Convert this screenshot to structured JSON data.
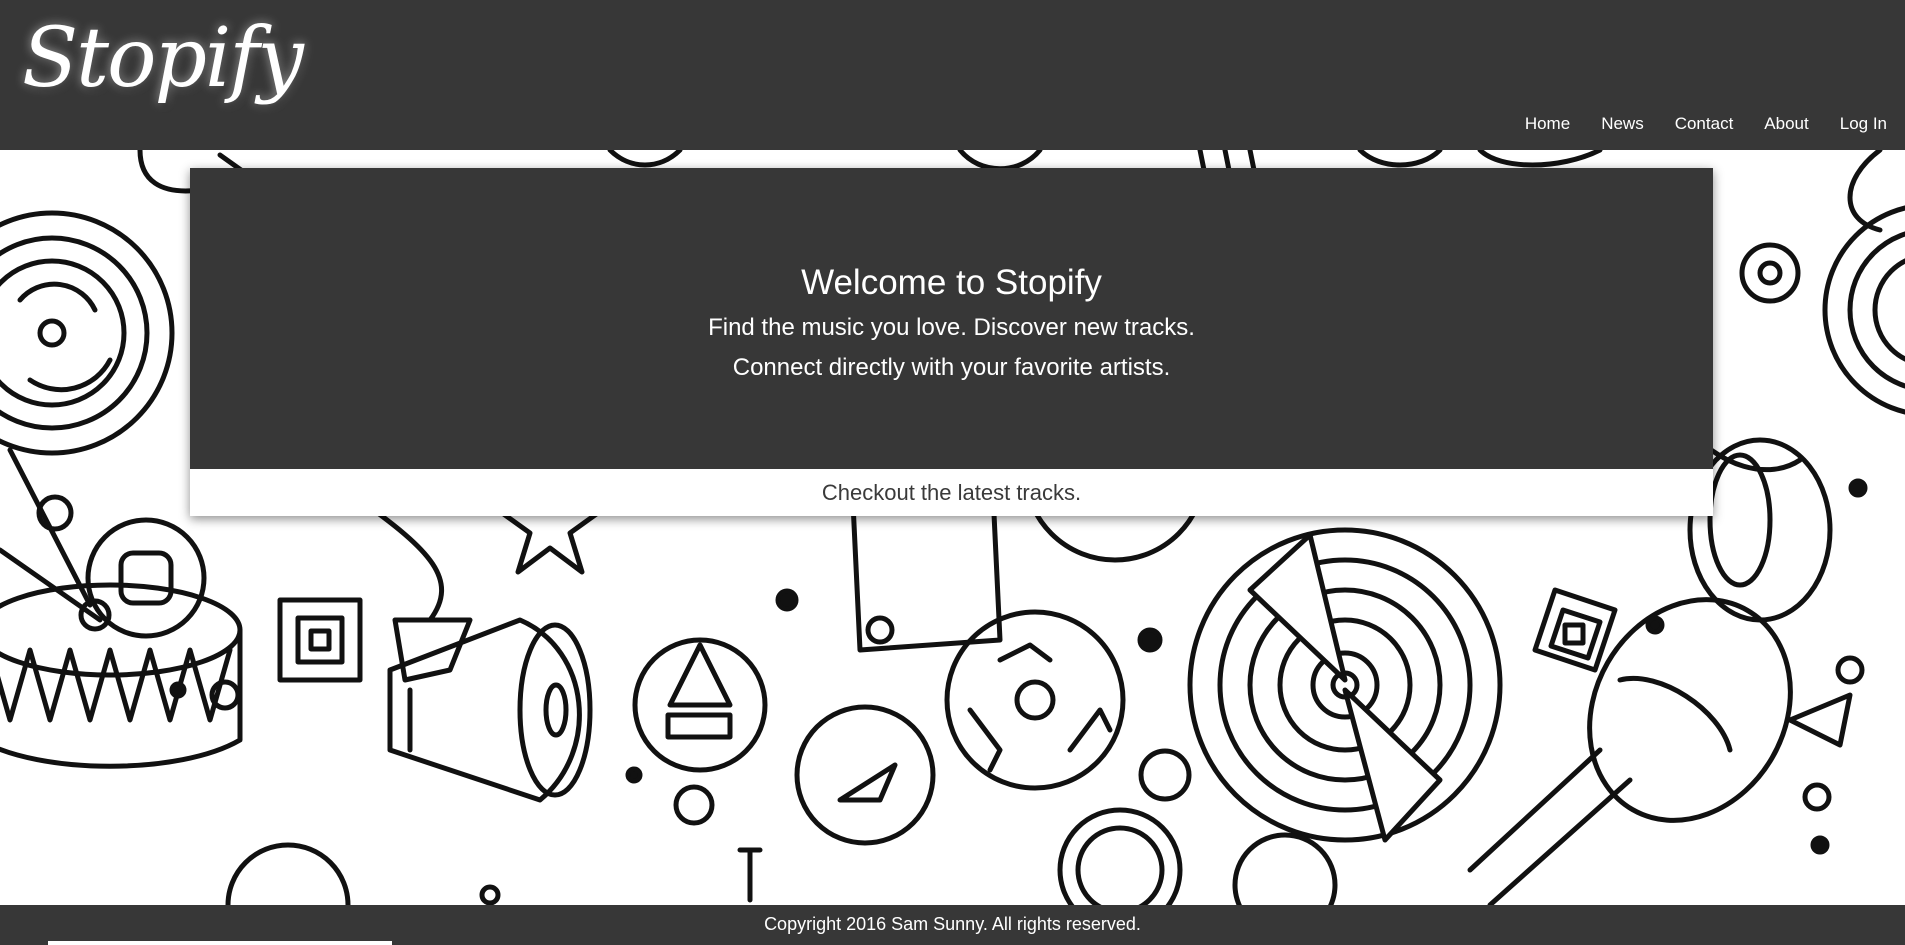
{
  "header": {
    "logo": "Stopify",
    "nav": [
      {
        "label": "Home"
      },
      {
        "label": "News"
      },
      {
        "label": "Contact"
      },
      {
        "label": "About"
      },
      {
        "label": "Log In"
      }
    ]
  },
  "hero": {
    "title": "Welcome to Stopify",
    "subtitle_line1": "Find the music you love. Discover new tracks.",
    "subtitle_line2": "Connect directly with your favorite artists.",
    "cta_text": "Checkout the latest tracks."
  },
  "footer": {
    "copyright": "Copyright 2016 Sam Sunny. All rights reserved."
  },
  "colors": {
    "header_bg": "#373737",
    "hero_bg": "#373737",
    "footer_bg": "#373737",
    "text_light": "#ffffff",
    "text_dark": "#3a3a3a"
  },
  "icons": {
    "background": "music-doodle-pattern"
  }
}
